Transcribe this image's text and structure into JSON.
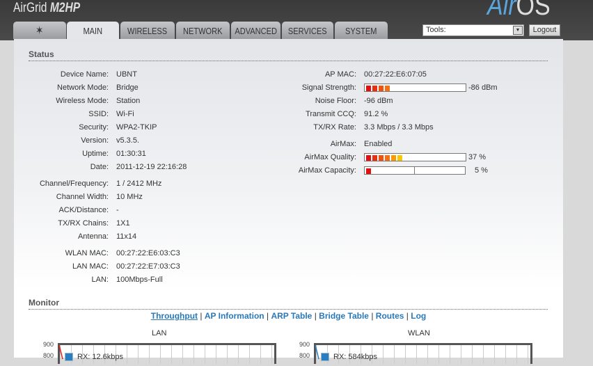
{
  "header": {
    "brand": "AirGrid",
    "model": "M2HP",
    "logo_air": "Air",
    "logo_os": "OS"
  },
  "tabs": [
    {
      "label": "MAIN"
    },
    {
      "label": "WIRELESS"
    },
    {
      "label": "NETWORK"
    },
    {
      "label": "ADVANCED"
    },
    {
      "label": "SERVICES"
    },
    {
      "label": "SYSTEM"
    }
  ],
  "tools": {
    "label": "Tools:"
  },
  "logout": "Logout",
  "status": {
    "title": "Status",
    "left": [
      {
        "label": "Device Name:",
        "value": "UBNT"
      },
      {
        "label": "Network Mode:",
        "value": "Bridge"
      },
      {
        "label": "Wireless Mode:",
        "value": "Station"
      },
      {
        "label": "SSID:",
        "value": "Wi-Fi"
      },
      {
        "label": "Security:",
        "value": "WPA2-TKIP"
      },
      {
        "label": "Version:",
        "value": "v5.3.5."
      },
      {
        "label": "Uptime:",
        "value": "01:30:31"
      },
      {
        "label": "Date:",
        "value": "2011-12-19 22:16:28"
      },
      {
        "label": "Channel/Frequency:",
        "value": "1 / 2412 MHz"
      },
      {
        "label": "Channel Width:",
        "value": "10 MHz"
      },
      {
        "label": "ACK/Distance:",
        "value": "-"
      },
      {
        "label": "TX/RX Chains:",
        "value": "1X1"
      },
      {
        "label": "Antenna:",
        "value": "11x14"
      },
      {
        "label": "WLAN MAC:",
        "value": "00:27:22:E6:03:C3"
      },
      {
        "label": "LAN MAC:",
        "value": "00:27:22:E7:03:C3"
      },
      {
        "label": "LAN:",
        "value": "100Mbps-Full"
      }
    ],
    "right": [
      {
        "label": "AP MAC:",
        "value": "00:27:22:E6:07:05"
      },
      {
        "label": "Signal Strength:",
        "value": "-86 dBm",
        "bar": 0.25
      },
      {
        "label": "Noise Floor:",
        "value": "-96 dBm"
      },
      {
        "label": "Transmit CCQ:",
        "value": "91.2 %"
      },
      {
        "label": "TX/RX Rate:",
        "value": "3.3 Mbps / 3.3 Mbps"
      },
      {
        "label": "AirMax:",
        "value": "Enabled"
      },
      {
        "label": "AirMax Quality:",
        "value": "37 %",
        "bar": 0.37
      },
      {
        "label": "AirMax Capacity:",
        "value": "5 %",
        "bar": 0.05,
        "capacity_max": 0.5
      }
    ]
  },
  "monitor": {
    "title": "Monitor",
    "links": [
      "Throughput",
      "AP Information",
      "ARP Table",
      "Bridge Table",
      "Routes",
      "Log"
    ],
    "separator": "|"
  },
  "charts": [
    {
      "title": "LAN",
      "yticks": [
        "900",
        "800"
      ],
      "legend": "RX: 12.6kbps"
    },
    {
      "title": "WLAN",
      "yticks": [
        "900",
        "800"
      ],
      "legend": "RX: 584kbps"
    }
  ]
}
